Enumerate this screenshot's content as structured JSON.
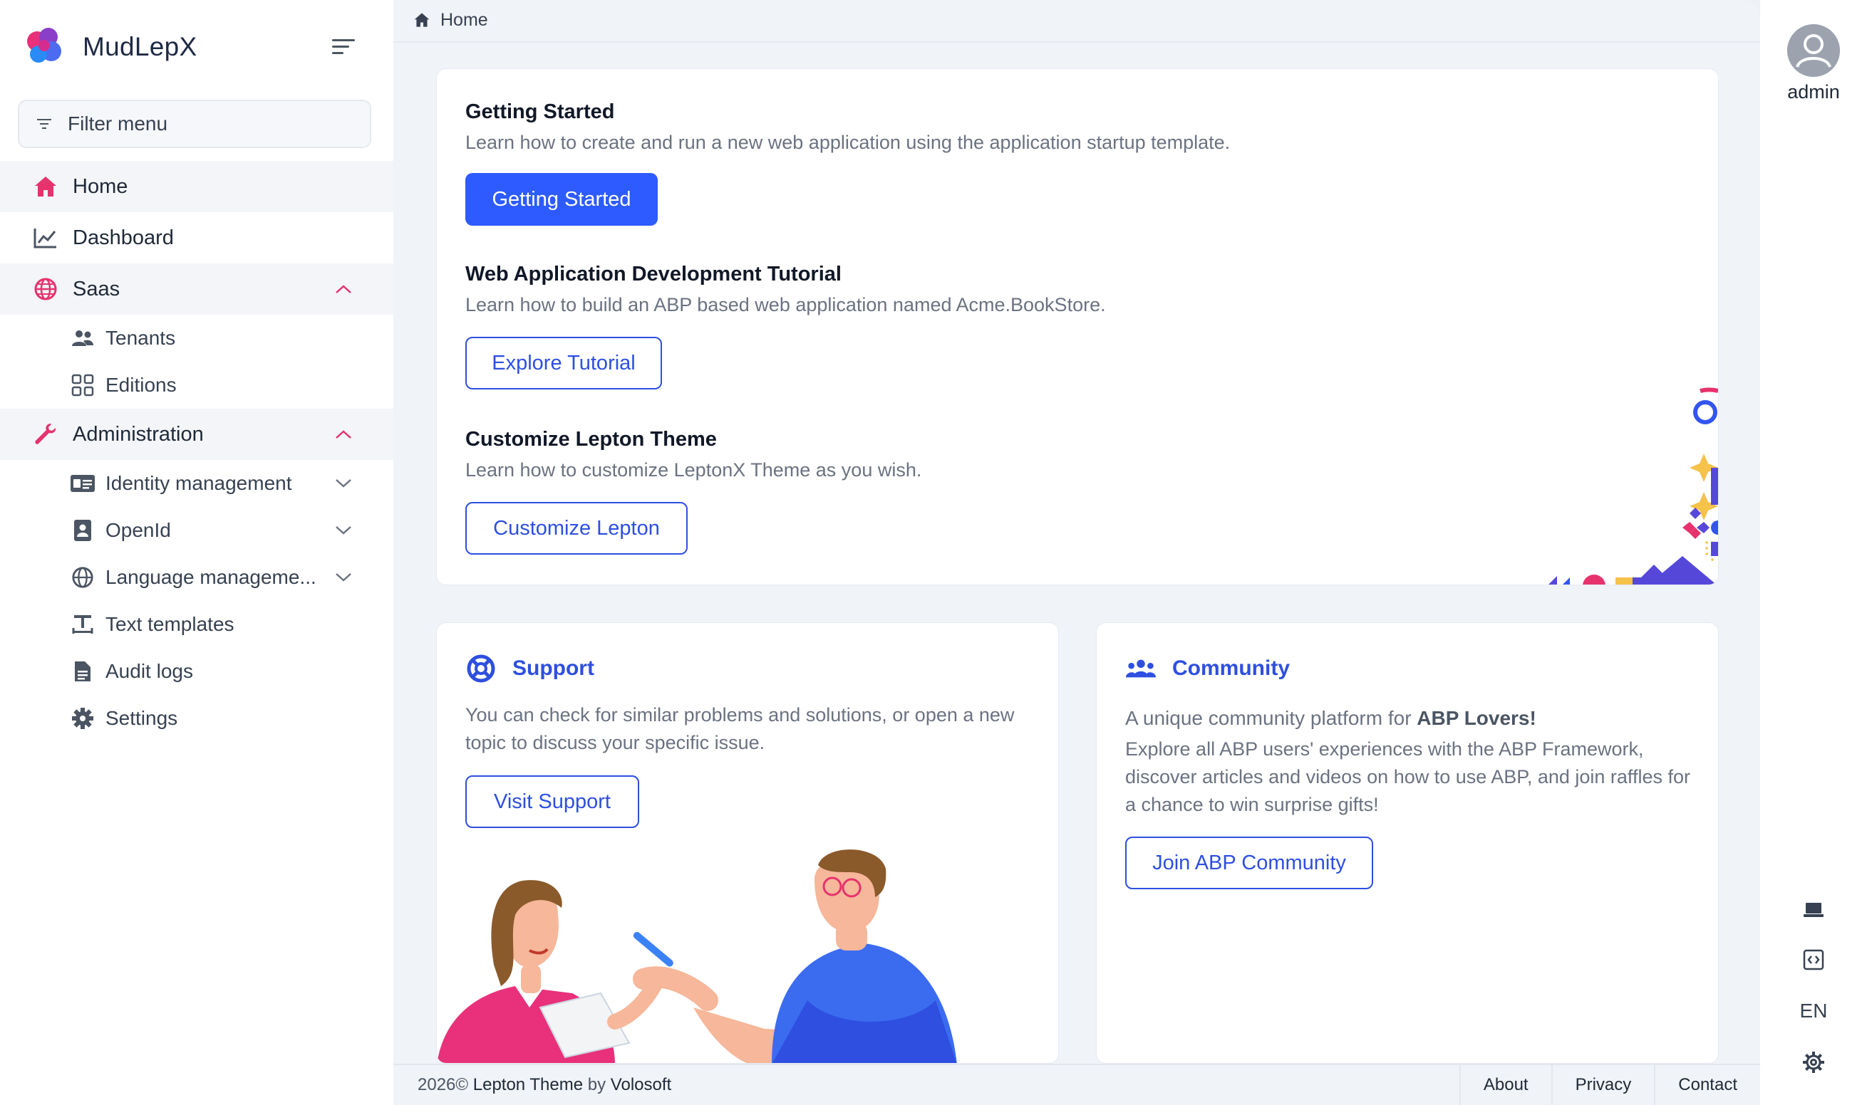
{
  "brand": {
    "name": "MudLepX"
  },
  "filter": {
    "placeholder": "Filter menu"
  },
  "nav": {
    "home": "Home",
    "dashboard": "Dashboard",
    "saas": "Saas",
    "tenants": "Tenants",
    "editions": "Editions",
    "administration": "Administration",
    "identity": "Identity management",
    "openid": "OpenId",
    "language": "Language manageme...",
    "text_templates": "Text templates",
    "audit_logs": "Audit logs",
    "settings": "Settings"
  },
  "breadcrumb": {
    "home": "Home"
  },
  "getting_started": {
    "title": "Getting Started",
    "desc": "Learn how to create and run a new web application using the application startup template.",
    "button": "Getting Started"
  },
  "tutorial": {
    "title": "Web Application Development Tutorial",
    "desc": "Learn how to build an ABP based web application named Acme.BookStore.",
    "button": "Explore Tutorial"
  },
  "customize": {
    "title": "Customize Lepton Theme",
    "desc": "Learn how to customize LeptonX Theme as you wish.",
    "button": "Customize Lepton"
  },
  "support": {
    "title": "Support",
    "desc": "You can check for similar problems and solutions, or open a new topic to discuss your specific issue.",
    "button": "Visit Support"
  },
  "community": {
    "title": "Community",
    "lead_prefix": "A unique community platform for ",
    "lead_bold": "ABP Lovers!",
    "desc": "Explore all ABP users' experiences with the ABP Framework, discover articles and videos on how to use ABP, and join raffles for a chance to win surprise gifts!",
    "button": "Join ABP Community"
  },
  "footer": {
    "year": "2026©",
    "brand": "Lepton Theme",
    "by": "by",
    "company": "Volosoft",
    "links": [
      "About",
      "Privacy",
      "Contact"
    ]
  },
  "user": {
    "name": "admin"
  },
  "toolbar": {
    "language": "EN"
  },
  "icons": {
    "home": "home-icon",
    "dashboard": "chart-line-icon",
    "saas": "globe-icon",
    "tenants": "users-icon",
    "editions": "grid-icon",
    "administration": "wrench-icon",
    "identity": "id-card-icon",
    "openid": "id-badge-icon",
    "language": "globe-icon",
    "text_templates": "text-icon",
    "audit_logs": "file-icon",
    "settings": "gear-icon"
  },
  "colors": {
    "accent": "#2e5bff",
    "nav_icon_active": "#e6336d",
    "text_link": "#2e4fe0"
  }
}
